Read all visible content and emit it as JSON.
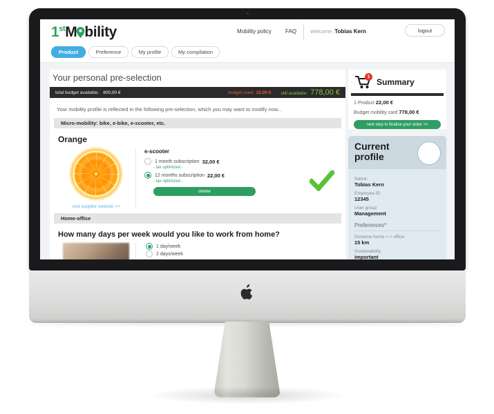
{
  "header": {
    "logo": {
      "prefix": "1",
      "sup": "st",
      "rest_a": "M",
      "rest_b": "bility",
      "pin_icon": "location-pin-icon"
    },
    "nav": [
      {
        "label": "Mobility policy"
      },
      {
        "label": "FAQ"
      }
    ],
    "welcome_prefix": "Welcome,",
    "user_name": "Tobias Kern",
    "logout_label": "logout"
  },
  "tabs": [
    {
      "label": "Product",
      "active": true
    },
    {
      "label": "Preference",
      "active": false
    },
    {
      "label": "My profile",
      "active": false
    },
    {
      "label": "My compilation",
      "active": false
    }
  ],
  "main": {
    "page_title": "Your personal pre-selection",
    "budget": {
      "total_label": "total budget available:",
      "total_value": "800,00 €",
      "used_label": "budget used:",
      "used_value": "22,00 €",
      "available_label": "still available:",
      "available_value": "778,00 €"
    },
    "intro": "Your mobility profile is reflected in the following pre-selection, which you may want to modify now...",
    "section_micro": "Micro-mobility: bike, e-bike, e-scooter, etc.",
    "product": {
      "name": "Orange",
      "image_alt": "orange-slice-photo",
      "supplier_link": "visit supplier website >>",
      "option_group_title": "e-scooter",
      "options": [
        {
          "label": "1 month subscription",
          "price": "32,00 €",
          "selected": false,
          "note": "- tax optimized -"
        },
        {
          "label": "12 months subscription",
          "price": "22,00 €",
          "selected": true,
          "note": "- tax optimized -"
        }
      ],
      "delete_label": "delete",
      "selected_icon": "green-check-icon"
    },
    "section_homeoffice": "Home-office",
    "homeoffice": {
      "question": "How many days per week would you like to work from home?",
      "image_alt": "home-office-photo",
      "options": [
        {
          "label": "1 day/week",
          "selected": true
        },
        {
          "label": "2 days/week",
          "selected": false
        }
      ]
    }
  },
  "sidebar": {
    "summary": {
      "cart_icon": "shopping-cart-icon",
      "badge_count": "1",
      "title": "Summary",
      "lines": [
        {
          "label": "1 Product",
          "value": "22,00 €"
        },
        {
          "label": "Budget mobility card",
          "value": "778,00 €"
        }
      ],
      "next_button": "next step to finalize your order >>"
    },
    "profile": {
      "title_line1": "Current",
      "title_line2": "profile",
      "avatar_icon": "avatar-placeholder-icon",
      "fields": [
        {
          "label": "Name:",
          "value": "Tobias Kern"
        },
        {
          "label": "Employee-ID",
          "value": "12345"
        },
        {
          "label": "User group",
          "value": "Management"
        }
      ],
      "preferences_heading": "Preferences*",
      "preferences": [
        {
          "label": "Distance home <-> office:",
          "value": "15 km"
        },
        {
          "label": "Sustainability",
          "value": "important"
        }
      ]
    }
  },
  "colors": {
    "brand_green": "#2e9e62",
    "tab_blue": "#42ade4",
    "budget_used_red": "#e0603c",
    "budget_available_green": "#8cc63f",
    "badge_red": "#e8342a"
  }
}
